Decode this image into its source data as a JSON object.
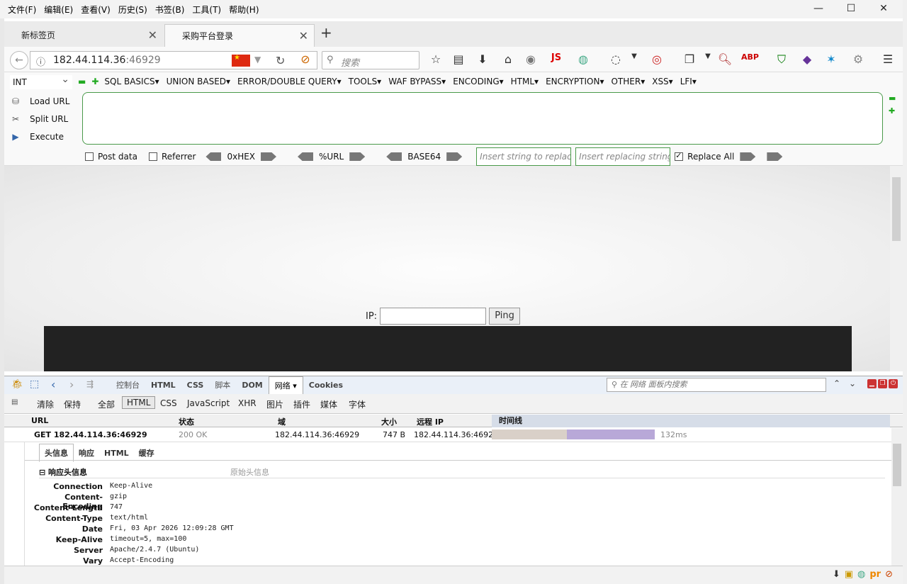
{
  "menubar": {
    "items": [
      "文件(F)",
      "编辑(E)",
      "查看(V)",
      "历史(S)",
      "书签(B)",
      "工具(T)",
      "帮助(H)"
    ],
    "minimize": "—",
    "maximize": "☐",
    "close": "✕"
  },
  "tabs": [
    {
      "label": "新标签页"
    },
    {
      "label": "采购平台登录"
    }
  ],
  "navbar": {
    "url_host": "182.44.114.36",
    "url_port": ":46929",
    "search_placeholder": "搜索"
  },
  "hackbar": {
    "select_value": "INT",
    "menus": [
      "SQL BASICS▾",
      "UNION BASED▾",
      "ERROR/DOUBLE QUERY▾",
      "TOOLS▾",
      "WAF BYPASS▾",
      "ENCODING▾",
      "HTML▾",
      "ENCRYPTION▾",
      "OTHER▾",
      "XSS▾",
      "LFI▾"
    ],
    "side": [
      "Load URL",
      "Split URL",
      "Execute"
    ],
    "post_data": "Post data",
    "referrer": "Referrer",
    "hex": "0xHEX",
    "url": "%URL",
    "base64": "BASE64",
    "replace_ph": "Insert string to replace",
    "replacing_ph": "Insert replacing string",
    "replace_all": "Replace All"
  },
  "page": {
    "ip_label": "IP:",
    "ping": "Ping"
  },
  "firebug": {
    "tabs": [
      "控制台",
      "HTML",
      "CSS",
      "脚本",
      "DOM",
      "网络 ▾",
      "Cookies"
    ],
    "search_placeholder": "在 网络 面板内搜索",
    "sub": [
      "清除",
      "保持",
      "全部",
      "HTML",
      "CSS",
      "JavaScript",
      "XHR",
      "图片",
      "插件",
      "媒体",
      "字体"
    ],
    "columns": {
      "url": "URL",
      "status": "状态",
      "domain": "域",
      "size": "大小",
      "remote": "远程 IP",
      "timeline": "时间线"
    },
    "request": {
      "method_url": "GET 182.44.114.36:46929",
      "status": "200 OK",
      "domain": "182.44.114.36:46929",
      "size": "747 B",
      "remote": "182.44.114.36:46929",
      "time": "132ms"
    },
    "detail_tabs": [
      "头信息",
      "响应",
      "HTML",
      "缓存"
    ],
    "resp_title": "响应头信息",
    "raw": "原始头信息",
    "headers": [
      {
        "k": "Connection",
        "v": "Keep-Alive"
      },
      {
        "k": "Content-Encoding",
        "v": "gzip"
      },
      {
        "k": "Content-Length",
        "v": "747"
      },
      {
        "k": "Content-Type",
        "v": "text/html"
      },
      {
        "k": "Date",
        "v": "Fri, 03 Apr 2026 12:09:28 GMT"
      },
      {
        "k": "Keep-Alive",
        "v": "timeout=5, max=100"
      },
      {
        "k": "Server",
        "v": "Apache/2.4.7 (Ubuntu)"
      },
      {
        "k": "Vary",
        "v": "Accept-Encoding"
      }
    ]
  }
}
